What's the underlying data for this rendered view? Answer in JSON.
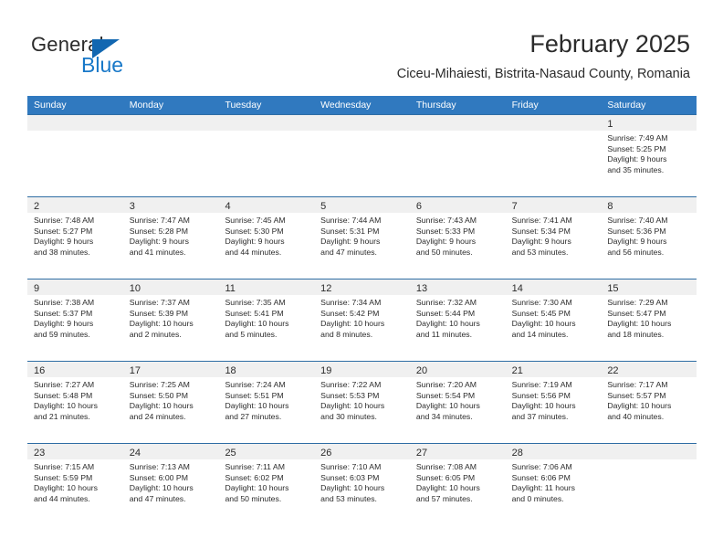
{
  "brand": {
    "word1": "General",
    "word2": "Blue",
    "triangle_color": "#1267b1",
    "blue_color": "#1878c8"
  },
  "header": {
    "title": "February 2025",
    "subtitle": "Ciceu-Mihaiesti, Bistrita-Nasaud County, Romania"
  },
  "calendar": {
    "header_bg": "#3079bf",
    "row_border": "#2e6da4",
    "daynum_band_bg": "#f0f0f0",
    "weekdays": [
      "Sunday",
      "Monday",
      "Tuesday",
      "Wednesday",
      "Thursday",
      "Friday",
      "Saturday"
    ],
    "weeks": [
      [
        {
          "day": ""
        },
        {
          "day": ""
        },
        {
          "day": ""
        },
        {
          "day": ""
        },
        {
          "day": ""
        },
        {
          "day": ""
        },
        {
          "day": "1",
          "sunrise": "Sunrise: 7:49 AM",
          "sunset": "Sunset: 5:25 PM",
          "daylight1": "Daylight: 9 hours",
          "daylight2": "and 35 minutes."
        }
      ],
      [
        {
          "day": "2",
          "sunrise": "Sunrise: 7:48 AM",
          "sunset": "Sunset: 5:27 PM",
          "daylight1": "Daylight: 9 hours",
          "daylight2": "and 38 minutes."
        },
        {
          "day": "3",
          "sunrise": "Sunrise: 7:47 AM",
          "sunset": "Sunset: 5:28 PM",
          "daylight1": "Daylight: 9 hours",
          "daylight2": "and 41 minutes."
        },
        {
          "day": "4",
          "sunrise": "Sunrise: 7:45 AM",
          "sunset": "Sunset: 5:30 PM",
          "daylight1": "Daylight: 9 hours",
          "daylight2": "and 44 minutes."
        },
        {
          "day": "5",
          "sunrise": "Sunrise: 7:44 AM",
          "sunset": "Sunset: 5:31 PM",
          "daylight1": "Daylight: 9 hours",
          "daylight2": "and 47 minutes."
        },
        {
          "day": "6",
          "sunrise": "Sunrise: 7:43 AM",
          "sunset": "Sunset: 5:33 PM",
          "daylight1": "Daylight: 9 hours",
          "daylight2": "and 50 minutes."
        },
        {
          "day": "7",
          "sunrise": "Sunrise: 7:41 AM",
          "sunset": "Sunset: 5:34 PM",
          "daylight1": "Daylight: 9 hours",
          "daylight2": "and 53 minutes."
        },
        {
          "day": "8",
          "sunrise": "Sunrise: 7:40 AM",
          "sunset": "Sunset: 5:36 PM",
          "daylight1": "Daylight: 9 hours",
          "daylight2": "and 56 minutes."
        }
      ],
      [
        {
          "day": "9",
          "sunrise": "Sunrise: 7:38 AM",
          "sunset": "Sunset: 5:37 PM",
          "daylight1": "Daylight: 9 hours",
          "daylight2": "and 59 minutes."
        },
        {
          "day": "10",
          "sunrise": "Sunrise: 7:37 AM",
          "sunset": "Sunset: 5:39 PM",
          "daylight1": "Daylight: 10 hours",
          "daylight2": "and 2 minutes."
        },
        {
          "day": "11",
          "sunrise": "Sunrise: 7:35 AM",
          "sunset": "Sunset: 5:41 PM",
          "daylight1": "Daylight: 10 hours",
          "daylight2": "and 5 minutes."
        },
        {
          "day": "12",
          "sunrise": "Sunrise: 7:34 AM",
          "sunset": "Sunset: 5:42 PM",
          "daylight1": "Daylight: 10 hours",
          "daylight2": "and 8 minutes."
        },
        {
          "day": "13",
          "sunrise": "Sunrise: 7:32 AM",
          "sunset": "Sunset: 5:44 PM",
          "daylight1": "Daylight: 10 hours",
          "daylight2": "and 11 minutes."
        },
        {
          "day": "14",
          "sunrise": "Sunrise: 7:30 AM",
          "sunset": "Sunset: 5:45 PM",
          "daylight1": "Daylight: 10 hours",
          "daylight2": "and 14 minutes."
        },
        {
          "day": "15",
          "sunrise": "Sunrise: 7:29 AM",
          "sunset": "Sunset: 5:47 PM",
          "daylight1": "Daylight: 10 hours",
          "daylight2": "and 18 minutes."
        }
      ],
      [
        {
          "day": "16",
          "sunrise": "Sunrise: 7:27 AM",
          "sunset": "Sunset: 5:48 PM",
          "daylight1": "Daylight: 10 hours",
          "daylight2": "and 21 minutes."
        },
        {
          "day": "17",
          "sunrise": "Sunrise: 7:25 AM",
          "sunset": "Sunset: 5:50 PM",
          "daylight1": "Daylight: 10 hours",
          "daylight2": "and 24 minutes."
        },
        {
          "day": "18",
          "sunrise": "Sunrise: 7:24 AM",
          "sunset": "Sunset: 5:51 PM",
          "daylight1": "Daylight: 10 hours",
          "daylight2": "and 27 minutes."
        },
        {
          "day": "19",
          "sunrise": "Sunrise: 7:22 AM",
          "sunset": "Sunset: 5:53 PM",
          "daylight1": "Daylight: 10 hours",
          "daylight2": "and 30 minutes."
        },
        {
          "day": "20",
          "sunrise": "Sunrise: 7:20 AM",
          "sunset": "Sunset: 5:54 PM",
          "daylight1": "Daylight: 10 hours",
          "daylight2": "and 34 minutes."
        },
        {
          "day": "21",
          "sunrise": "Sunrise: 7:19 AM",
          "sunset": "Sunset: 5:56 PM",
          "daylight1": "Daylight: 10 hours",
          "daylight2": "and 37 minutes."
        },
        {
          "day": "22",
          "sunrise": "Sunrise: 7:17 AM",
          "sunset": "Sunset: 5:57 PM",
          "daylight1": "Daylight: 10 hours",
          "daylight2": "and 40 minutes."
        }
      ],
      [
        {
          "day": "23",
          "sunrise": "Sunrise: 7:15 AM",
          "sunset": "Sunset: 5:59 PM",
          "daylight1": "Daylight: 10 hours",
          "daylight2": "and 44 minutes."
        },
        {
          "day": "24",
          "sunrise": "Sunrise: 7:13 AM",
          "sunset": "Sunset: 6:00 PM",
          "daylight1": "Daylight: 10 hours",
          "daylight2": "and 47 minutes."
        },
        {
          "day": "25",
          "sunrise": "Sunrise: 7:11 AM",
          "sunset": "Sunset: 6:02 PM",
          "daylight1": "Daylight: 10 hours",
          "daylight2": "and 50 minutes."
        },
        {
          "day": "26",
          "sunrise": "Sunrise: 7:10 AM",
          "sunset": "Sunset: 6:03 PM",
          "daylight1": "Daylight: 10 hours",
          "daylight2": "and 53 minutes."
        },
        {
          "day": "27",
          "sunrise": "Sunrise: 7:08 AM",
          "sunset": "Sunset: 6:05 PM",
          "daylight1": "Daylight: 10 hours",
          "daylight2": "and 57 minutes."
        },
        {
          "day": "28",
          "sunrise": "Sunrise: 7:06 AM",
          "sunset": "Sunset: 6:06 PM",
          "daylight1": "Daylight: 11 hours",
          "daylight2": "and 0 minutes."
        },
        {
          "day": ""
        }
      ]
    ]
  }
}
